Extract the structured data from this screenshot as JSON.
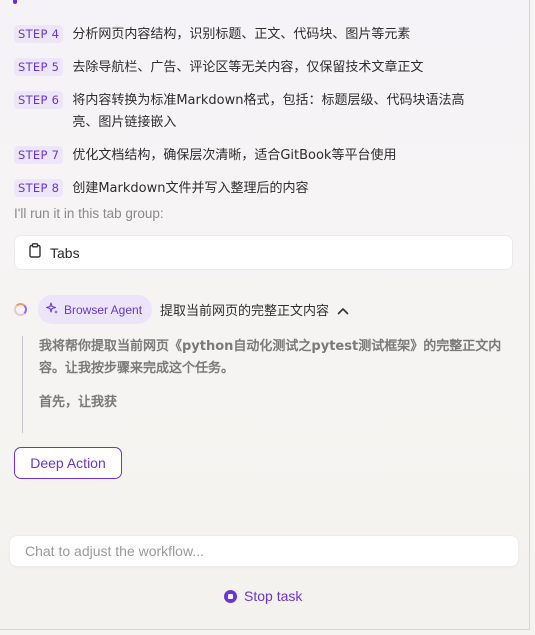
{
  "steps": [
    {
      "tag": "STEP 4",
      "text": "分析网页内容结构，识别标题、正文、代码块、图片等元素"
    },
    {
      "tag": "STEP 5",
      "text": "去除导航栏、广告、评论区等无关内容，仅保留技术文章正文"
    },
    {
      "tag": "STEP 6",
      "text_line1": "将内容转换为标准Markdown格式，包括：标题层级、代码块语法高",
      "text_line2": "亮、图片链接嵌入"
    },
    {
      "tag": "STEP 7",
      "text": "优化文档结构，确保层次清晰，适合GitBook等平台使用"
    },
    {
      "tag": "STEP 8",
      "text": "创建Markdown文件并写入整理后的内容"
    }
  ],
  "tab_group": {
    "label": "I'll run it in this tab group:",
    "tabs_label": "Tabs",
    "tabs_icon": "clipboard-icon"
  },
  "agent": {
    "badge": "Browser Agent",
    "badge_icon": "sparkle-icon",
    "task": "提取当前网页的完整正文内容",
    "message_line1": "我将帮你提取当前网页《python自动化测试之pytest测试框架》的完整正文内",
    "message_line2": "容。让我按步骤来完成这个任务。",
    "message2": "首先，让我获"
  },
  "deep_action_label": "Deep Action",
  "chat": {
    "placeholder": "Chat to adjust the workflow...",
    "value": ""
  },
  "stop_task_label": "Stop task",
  "colors": {
    "accent": "#6a35d8",
    "accent_bg": "#ece6f8",
    "background": "#f6f4f2"
  }
}
